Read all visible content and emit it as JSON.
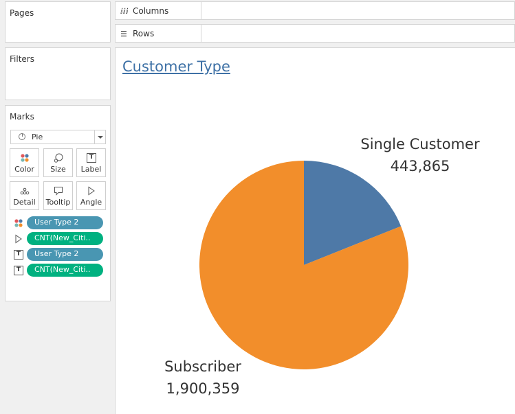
{
  "cards": {
    "pages": "Pages",
    "filters": "Filters",
    "marks": "Marks"
  },
  "marks": {
    "type": "Pie",
    "buttons": {
      "color": "Color",
      "size": "Size",
      "label": "Label",
      "detail": "Detail",
      "tooltip": "Tooltip",
      "angle": "Angle"
    },
    "pills": [
      {
        "text": "User Type 2",
        "kind": "dimension",
        "icon": "color-dots-icon"
      },
      {
        "text": "CNT(New_Citi..",
        "kind": "measure",
        "icon": "angle-icon"
      },
      {
        "text": "User Type 2",
        "kind": "dimension",
        "icon": "label-T-icon"
      },
      {
        "text": "CNT(New_Citi..",
        "kind": "measure",
        "icon": "label-T-icon"
      }
    ]
  },
  "shelves": {
    "columns": "Columns",
    "rows": "Rows"
  },
  "colors": {
    "single_customer": "#4e79a7",
    "subscriber": "#f28e2b",
    "title": "#3e71a6"
  },
  "chart_data": {
    "type": "pie",
    "title": "Customer Type",
    "slices": [
      {
        "label": "Single Customer",
        "value": 443865,
        "value_text": "443,865",
        "color": "#4e79a7"
      },
      {
        "label": "Subscriber",
        "value": 1900359,
        "value_text": "1,900,359",
        "color": "#f28e2b"
      }
    ],
    "start": "12 o'clock",
    "direction": "clockwise"
  }
}
